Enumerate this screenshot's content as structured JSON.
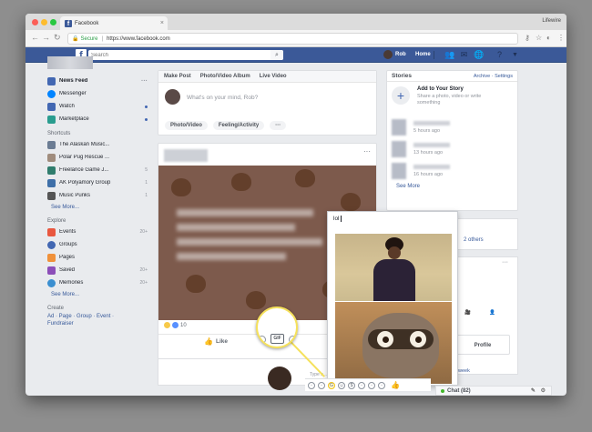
{
  "browser": {
    "tab_title": "Facebook",
    "user_name": "Lifewire",
    "secure_label": "Secure",
    "url": "https://www.facebook.com"
  },
  "header": {
    "search_placeholder": "Search",
    "profile_name": "Rob",
    "home_label": "Home",
    "brand_color": "#3b5998"
  },
  "sidebar": {
    "main_items": [
      {
        "label": "News Feed",
        "icon": "news-feed-icon",
        "color": "#4267b2"
      },
      {
        "label": "Messenger",
        "icon": "messenger-icon",
        "color": "#0084ff"
      },
      {
        "label": "Watch",
        "icon": "watch-icon",
        "color": "#4267b2"
      },
      {
        "label": "Marketplace",
        "icon": "marketplace-icon",
        "color": "#2a9d8f"
      }
    ],
    "shortcuts_title": "Shortcuts",
    "shortcuts": [
      {
        "label": "The Alaskan Music...",
        "badge": ""
      },
      {
        "label": "Polar Pug Rescue ...",
        "badge": ""
      },
      {
        "label": "Freelance Game J...",
        "badge": "5"
      },
      {
        "label": "AK Polyamory Group",
        "badge": "1"
      },
      {
        "label": "Music Punks",
        "badge": "1"
      }
    ],
    "see_more": "See More...",
    "explore_title": "Explore",
    "explore": [
      {
        "label": "Events",
        "badge": "20+",
        "icon": "events-icon",
        "color": "#e9573f"
      },
      {
        "label": "Groups",
        "badge": "",
        "icon": "groups-icon",
        "color": "#4267b2"
      },
      {
        "label": "Pages",
        "badge": "",
        "icon": "pages-icon",
        "color": "#f0913a"
      },
      {
        "label": "Saved",
        "badge": "20+",
        "icon": "saved-icon",
        "color": "#8c4eb8"
      },
      {
        "label": "Memories",
        "badge": "20+",
        "icon": "memories-icon",
        "color": "#3b8fd0"
      }
    ],
    "create_title": "Create",
    "create_links": "Ad · Page · Group · Event · Fundraiser"
  },
  "composer": {
    "tabs": [
      "Make Post",
      "Photo/Video Album",
      "Live Video"
    ],
    "prompt": "What's on your mind, Rob?",
    "actions": [
      "Photo/Video",
      "Feeling/Activity",
      "···"
    ]
  },
  "post": {
    "options": "···",
    "reaction_count": "10",
    "like_label": "Like"
  },
  "stories": {
    "title": "Stories",
    "links": "Archive · Settings",
    "add_title": "Add to Your Story",
    "add_sub": "Share a photo, video or write something",
    "times": [
      "5 hours ago",
      "13 hours ago",
      "16 hours ago"
    ],
    "see_more": "See More"
  },
  "right_panel": {
    "others": "2 others",
    "more": "···",
    "items": [
      "Profile"
    ],
    "link": "week"
  },
  "gif_picker": {
    "query": "lol",
    "type_hint": "Type a..."
  },
  "chat": {
    "label": "Chat (82)"
  },
  "zoom": {
    "gif_label": "GIF"
  }
}
